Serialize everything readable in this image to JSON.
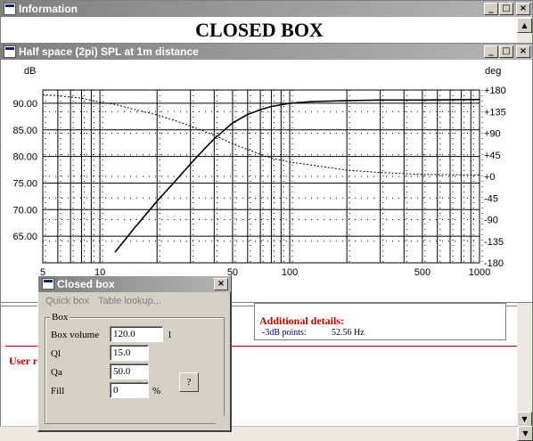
{
  "info_window": {
    "title": "Information",
    "heading": "CLOSED BOX",
    "details_title": "Additional details:",
    "details_key": "-3dB points:",
    "details_value": "52.56 Hz",
    "user_label": "User r"
  },
  "chart_window": {
    "title": "Half space (2pi) SPL at 1m distance"
  },
  "chart_data": {
    "type": "line",
    "title": "Half space (2pi) SPL at 1m distance",
    "ylabel": "dB",
    "y2label": "deg",
    "xscale": "log",
    "xlim": [
      5,
      1000
    ],
    "ylim": [
      60,
      92.5
    ],
    "y2lim": [
      -180,
      180
    ],
    "xticks": [
      "5",
      "10",
      "50",
      "100",
      "500",
      "1000"
    ],
    "yticks": [
      "90.00",
      "85.00",
      "80.00",
      "75.00",
      "70.00",
      "65.00"
    ],
    "y2ticks": [
      "+180",
      "+135",
      "+90",
      "+45",
      "+0",
      "-45",
      "-90",
      "-135",
      "-180"
    ],
    "grid": true,
    "series": [
      {
        "style": "solid",
        "axis": "left",
        "x": [
          12,
          15,
          20,
          25,
          30,
          35,
          40,
          50,
          60,
          70,
          80,
          100,
          130,
          200,
          300,
          500,
          1000
        ],
        "y": [
          62.0,
          66.3,
          71.6,
          75.4,
          78.6,
          81.2,
          83.3,
          86.3,
          87.9,
          88.8,
          89.4,
          90.0,
          90.3,
          90.5,
          90.6,
          90.6,
          90.7
        ]
      },
      {
        "style": "dashed",
        "axis": "right",
        "x": [
          5,
          6,
          8,
          10,
          12,
          15,
          20,
          25,
          30,
          40,
          50,
          60,
          70,
          80,
          100,
          150,
          200,
          300,
          500,
          1000
        ],
        "y": [
          170,
          168,
          163,
          155,
          150,
          140,
          128,
          116,
          105,
          86,
          68,
          56,
          46,
          38,
          30,
          20,
          13,
          8,
          4,
          3
        ]
      }
    ]
  },
  "dialog": {
    "title": "Closed box",
    "tab_quick": "Quick box",
    "tab_table": "Table lookup...",
    "group_label": "Box",
    "fields": {
      "box_volume_label": "Box volume",
      "box_volume_value": "120.0",
      "box_volume_unit": "l",
      "ql_label": "Ql",
      "ql_value": "15.0",
      "qa_label": "Qa",
      "qa_value": "50.0",
      "fill_label": "Fill",
      "fill_value": "0",
      "fill_unit": "%"
    },
    "help_label": "?"
  },
  "colors": {
    "titlebar_inactive": "#808080",
    "detail_red": "#c00000",
    "detail_blue": "#00008b"
  }
}
